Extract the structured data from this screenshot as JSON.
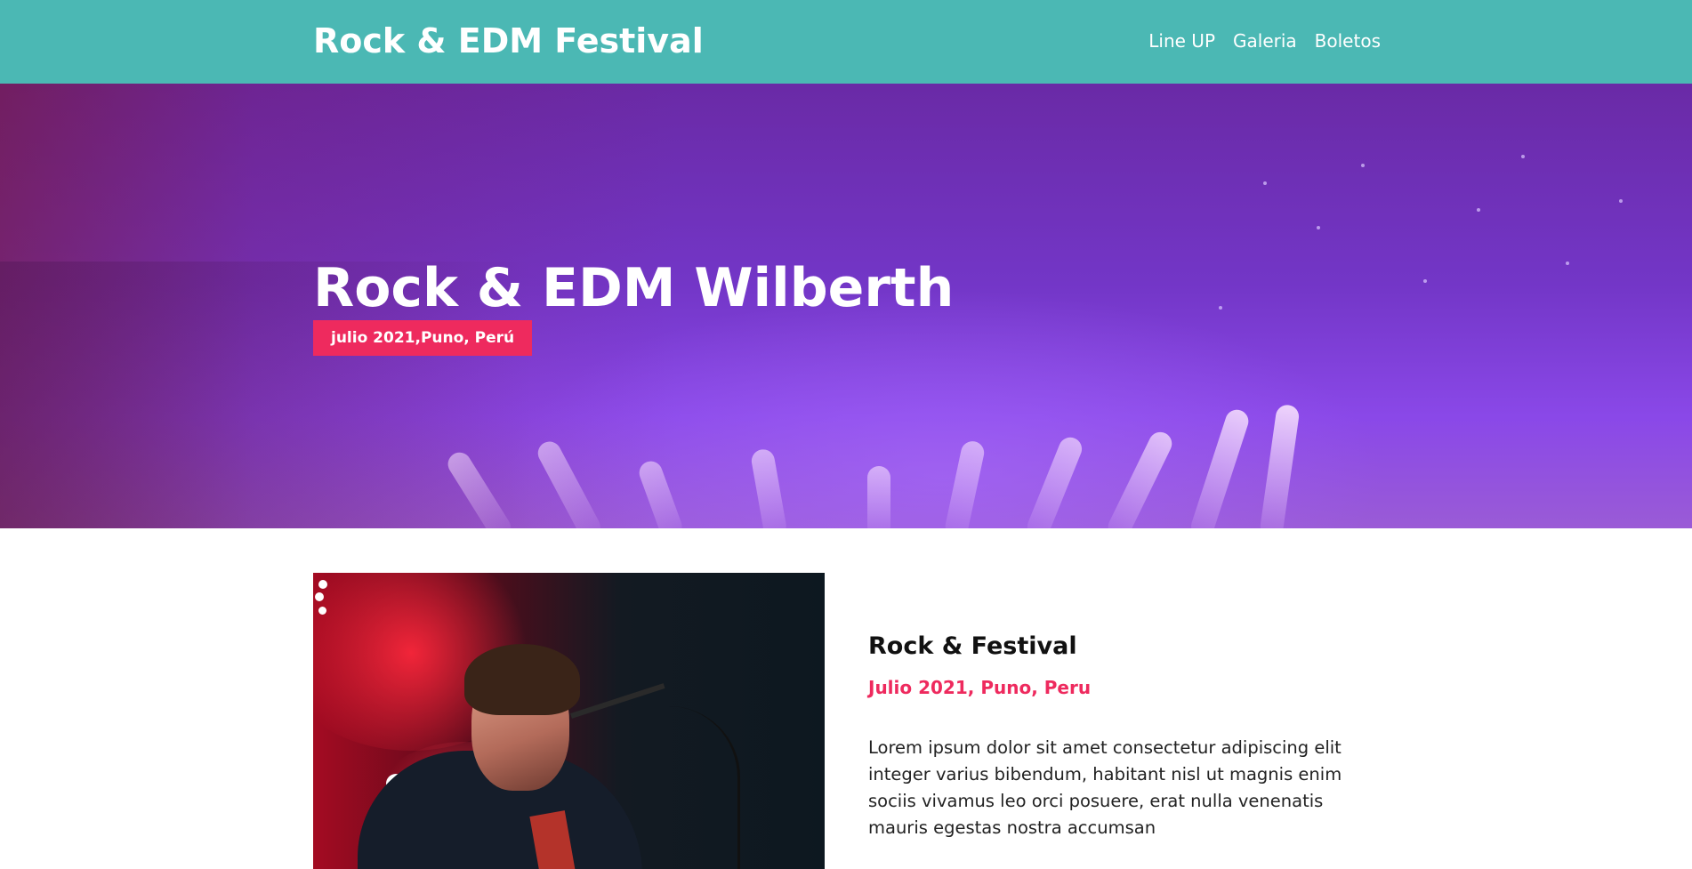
{
  "header": {
    "brand": "Rock & EDM Festival",
    "nav": [
      {
        "label": "Line UP"
      },
      {
        "label": "Galeria"
      },
      {
        "label": "Boletos"
      }
    ],
    "background_color": "#4bb8b4"
  },
  "hero": {
    "title": "Rock & EDM Wilberth",
    "badge": "julio 2021,Puno, Perú",
    "badge_color": "#ee2a5e"
  },
  "event": {
    "title": "Rock & Festival",
    "date": "Julio 2021, Puno, Peru",
    "description": "Lorem ipsum dolor sit amet consectetur adipiscing elit integer varius bibendum, habitant nisl ut magnis enim sociis vivamus leo orci posuere, erat nulla venenatis mauris egestas nostra accumsan",
    "date_color": "#ee2a5e"
  }
}
